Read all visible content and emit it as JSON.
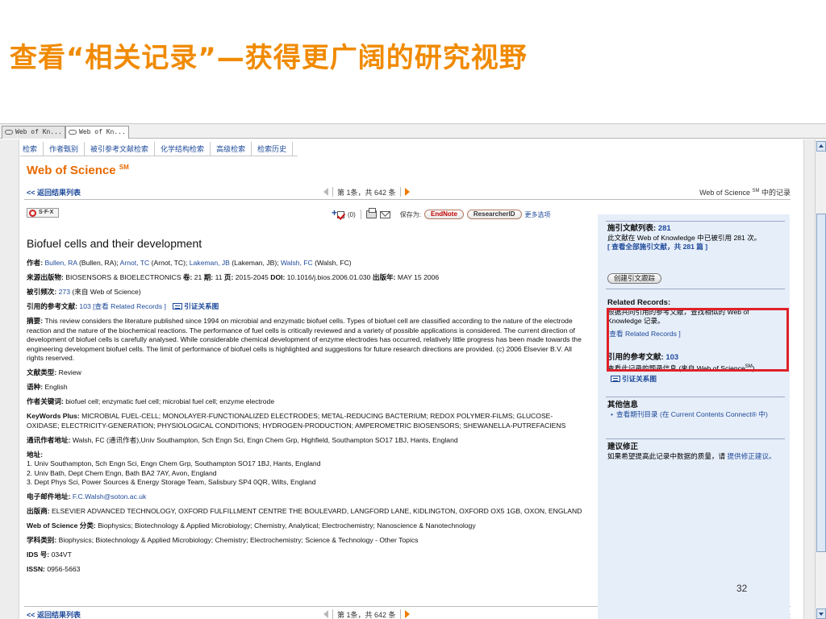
{
  "slide": {
    "title": "查看“相关记录”—获得更广阔的研究视野",
    "page_number": "32"
  },
  "browser": {
    "tabs": [
      {
        "label": "Web of Kn..."
      },
      {
        "label": "Web of Kn..."
      }
    ]
  },
  "nav": {
    "items": [
      "检索",
      "作者甄别",
      "被引参考文献检索",
      "化学结构检索",
      "高级检索",
      "检索历史"
    ]
  },
  "logo": {
    "text": "Web of Science",
    "mark": "SM"
  },
  "record_bar": {
    "back": "<< 返回结果列表",
    "pager": "第 1条，共 642 条",
    "record_in_pre": "Web of Science",
    "record_in_sup": "SM",
    "record_in_post": " 中的记录"
  },
  "toolbar": {
    "sfx_label": "S·F·X",
    "mark_count": "(0)",
    "save_to": "保存为:",
    "endnote": "EndNote",
    "researcherid": "ResearcherID",
    "more_options": "更多选项"
  },
  "article": {
    "title": "Biofuel cells and their development",
    "authors_label": "作者:",
    "authors": [
      {
        "link": "Bullen, RA",
        "full": " (Bullen, RA); "
      },
      {
        "link": "Arnot, TC",
        "full": " (Arnot, TC); "
      },
      {
        "link": "Lakeman, JB",
        "full": " (Lakeman, JB); "
      },
      {
        "link": "Walsh, FC",
        "full": " (Walsh, FC)"
      }
    ],
    "source_label": "来源出版物:",
    "source": "BIOSENSORS & BIOELECTRONICS",
    "volume_label": "卷:",
    "volume": "21",
    "issue_label": "期:",
    "issue": "11",
    "pages_label": "页:",
    "pages": "2015-2045",
    "doi_label": "DOI:",
    "doi": "10.1016/j.bios.2006.01.030",
    "pubdate_label": "出版年:",
    "pubdate": "MAY 15 2006",
    "times_cited_label": "被引频次:",
    "times_cited": "273",
    "times_cited_note": " (来自 Web of Science)",
    "refs_label": "引用的参考文献:",
    "refs_count": "103",
    "refs_view": " [查看 Related Records ]",
    "citation_map": "引证关系图",
    "abstract_label": "摘要:",
    "abstract": "This review considers the literature published since 1994 on microbial and enzymatic biofuel cells. Types of biofuel cell are classified according to the nature of the electrode reaction and the nature of the biochemical reactions. The performance of fuel cells is critically reviewed and a variety of possible applications is considered. The current direction of development of biofuel cells is carefully analysed. While considerable chemical development of enzyme electrodes has occurred, relatively little progress has been made towards the engineering development biofuel cells. The limit of performance of biofuel cells is highlighted and suggestions for future research directions are provided. (c) 2006 Elsevier B.V. All rights reserved.",
    "doctype_label": "文献类型:",
    "doctype": "Review",
    "language_label": "语种:",
    "language": "English",
    "keywords_label": "作者关键词:",
    "keywords": "biofuel cell; enzymatic fuel cell; microbial fuel cell; enzyme electrode",
    "kwplus_label": "KeyWords Plus:",
    "kwplus": "MICROBIAL FUEL-CELL; MONOLAYER-FUNCTIONALIZED ELECTRODES; METAL-REDUCING BACTERIUM; REDOX POLYMER-FILMS; GLUCOSE-OXIDASE; ELECTRICITY-GENERATION; PHYSIOLOGICAL CONDITIONS; HYDROGEN-PRODUCTION; AMPEROMETRIC BIOSENSORS; SHEWANELLA-PUTREFACIENS",
    "reprint_label": "通讯作者地址:",
    "reprint": "Walsh, FC (通讯作者),Univ Southampton, Sch Engn Sci, Engn Chem Grp, Highfield, Southampton SO17 1BJ, Hants, England",
    "address_label": "地址:",
    "addresses": [
      "1. Univ Southampton, Sch Engn Sci, Engn Chem Grp, Southampton SO17 1BJ, Hants, England",
      "2. Univ Bath, Dept Chem Engn, Bath BA2 7AY, Avon, England",
      "3. Dept Phys Sci, Power Sources & Energy Storage Team, Salisbury SP4 0QR, Wilts, England"
    ],
    "email_label": "电子邮件地址:",
    "email": "F.C.Walsh@soton.ac.uk",
    "publisher_label": "出版商:",
    "publisher": "ELSEVIER ADVANCED TECHNOLOGY, OXFORD FULFILLMENT CENTRE THE BOULEVARD, LANGFORD LANE, KIDLINGTON, OXFORD OX5 1GB, OXON, ENGLAND",
    "wos_cat_label": "Web of Science 分类:",
    "wos_cat": "Biophysics; Biotechnology & Applied Microbiology; Chemistry, Analytical; Electrochemistry; Nanoscience & Nanotechnology",
    "subject_label": "学科类别:",
    "subject": "Biophysics; Biotechnology & Applied Microbiology; Chemistry; Electrochemistry; Science & Technology - Other Topics",
    "ids_label": "IDS 号:",
    "ids": "034VT",
    "issn_label": "ISSN:",
    "issn": "0956-5663"
  },
  "sidebar": {
    "citing_head": "施引文献列表:",
    "citing_count": "281",
    "citing_desc": "此文献在 Web of Knowledge 中已被引用 281 次。",
    "citing_link": "[ 查看全部施引文献，共 281 篇 ]",
    "track_button": "创建引文跟踪",
    "related_head": "Related Records:",
    "related_desc": "根据共同引用的参考文献，查找相似的 Web of Knowledge 记录。",
    "related_link": "[查看 Related Records ]",
    "refs_head": "引用的参考文献:",
    "refs_count": "103",
    "refs_desc": "查看此记录的题录信息 (来自 Web of Science",
    "refs_desc_sup": "SM",
    "refs_desc_end": ")。",
    "citation_map": "引证关系图",
    "other_head": "其他信息",
    "other_link": "查看期刊目录 (在 Current Contents Connect® 中)",
    "suggest_head": "建议修正",
    "suggest_desc": "如果希望提高此记录中数据的质量，请",
    "suggest_link": "提供修正建议。"
  }
}
